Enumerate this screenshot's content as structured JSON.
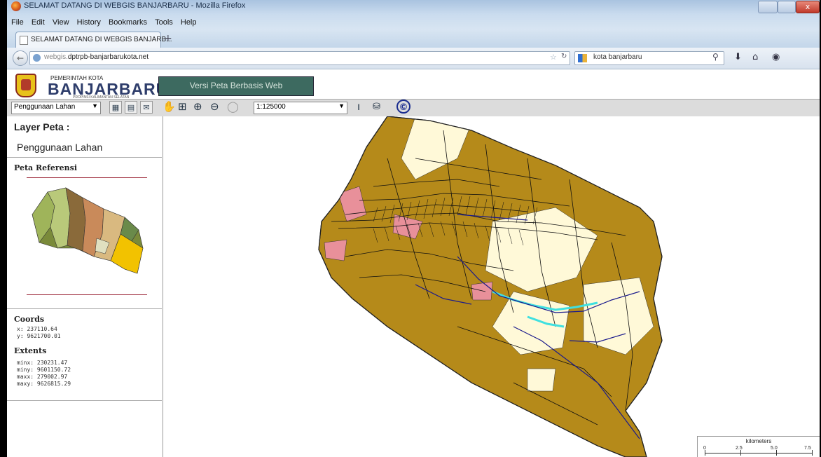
{
  "window": {
    "title": "SELAMAT DATANG DI WEBGIS BANJARBARU - Mozilla Firefox",
    "close_glyph": "x"
  },
  "menu": [
    "File",
    "Edit",
    "View",
    "History",
    "Bookmarks",
    "Tools",
    "Help"
  ],
  "tab": {
    "label": "SELAMAT DATANG DI WEBGIS BANJARB...",
    "new_tab": "+"
  },
  "url": {
    "prefix": "webgis.",
    "domain": "dptrpb-banjarbarukota.net"
  },
  "search": {
    "value": "kota banjarbaru"
  },
  "site": {
    "gov_label": "PEMERINTAH KOTA",
    "city": "BANJARBARU",
    "province": "PROPINSI KALIMANTAN SELATAN",
    "banner": "Versi Peta Berbasis Web"
  },
  "toolbar": {
    "layer_select": "Penggunaan Lahan",
    "scale_select": "1:125000",
    "copyright": "©"
  },
  "sidebar": {
    "layer_title": "Layer Peta :",
    "layer_value": "Penggunaan Lahan",
    "reference_title": "Peta Referensi",
    "coords_title": "Coords",
    "x": "x: 237110.64",
    "y": "y: 9621700.01",
    "extents_title": "Extents",
    "minx": "minx: 230231.47",
    "miny": "miny: 9601150.72",
    "maxx": "maxx: 279002.97",
    "maxy": "maxy: 9626815.29"
  },
  "map": {
    "scalebar_unit": "kilometers",
    "scalebar_ticks": [
      "0",
      "2.5",
      "5.0",
      "7.5"
    ]
  },
  "colors": {
    "land_dominant": "#b58a1a",
    "land_light": "#fff9d8",
    "settlement": "#e8909a",
    "water": "#40e0e0",
    "river": "#1a1a8c",
    "road": "#101010"
  }
}
